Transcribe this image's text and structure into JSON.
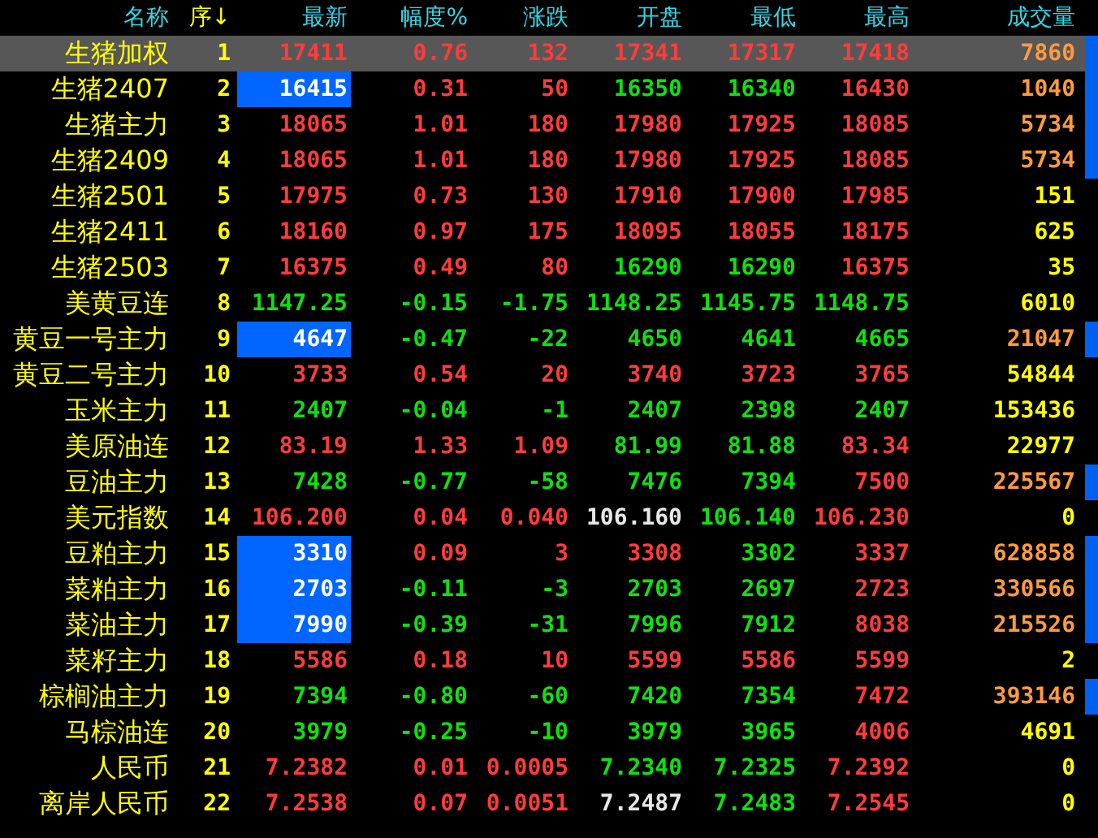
{
  "columns": [
    {
      "label": "名称"
    },
    {
      "label": "序",
      "sort_arrow": "↓"
    },
    {
      "label": "最新"
    },
    {
      "label": "幅度%"
    },
    {
      "label": "涨跌"
    },
    {
      "label": "开盘"
    },
    {
      "label": "最低"
    },
    {
      "label": "最高"
    },
    {
      "label": "成交量"
    }
  ],
  "rows": [
    {
      "name": "生猪加权",
      "seq": "1",
      "selected": true,
      "flagged": true,
      "latest_highlighted": false,
      "values": [
        {
          "text": "17411",
          "color": "#ff3c3c"
        },
        {
          "text": "0.76",
          "color": "#ff3c3c"
        },
        {
          "text": "132",
          "color": "#ff3c3c"
        },
        {
          "text": "17341",
          "color": "#ff3c3c"
        },
        {
          "text": "17317",
          "color": "#ff3c3c"
        },
        {
          "text": "17418",
          "color": "#ff3c3c"
        }
      ],
      "volume": "7860"
    },
    {
      "name": "生猪2407",
      "seq": "2",
      "selected": false,
      "flagged": true,
      "latest_highlighted": true,
      "values": [
        {
          "text": "16415",
          "color": "#ffffff"
        },
        {
          "text": "0.31",
          "color": "#ff3c3c"
        },
        {
          "text": "50",
          "color": "#ff3c3c"
        },
        {
          "text": "16350",
          "color": "#10e010"
        },
        {
          "text": "16340",
          "color": "#10e010"
        },
        {
          "text": "16430",
          "color": "#ff3c3c"
        }
      ],
      "volume": "1040"
    },
    {
      "name": "生猪主力",
      "seq": "3",
      "selected": false,
      "flagged": true,
      "latest_highlighted": false,
      "values": [
        {
          "text": "18065",
          "color": "#ff3c3c"
        },
        {
          "text": "1.01",
          "color": "#ff3c3c"
        },
        {
          "text": "180",
          "color": "#ff3c3c"
        },
        {
          "text": "17980",
          "color": "#ff3c3c"
        },
        {
          "text": "17925",
          "color": "#ff3c3c"
        },
        {
          "text": "18085",
          "color": "#ff3c3c"
        }
      ],
      "volume": "5734"
    },
    {
      "name": "生猪2409",
      "seq": "4",
      "selected": false,
      "flagged": true,
      "latest_highlighted": false,
      "values": [
        {
          "text": "18065",
          "color": "#ff3c3c"
        },
        {
          "text": "1.01",
          "color": "#ff3c3c"
        },
        {
          "text": "180",
          "color": "#ff3c3c"
        },
        {
          "text": "17980",
          "color": "#ff3c3c"
        },
        {
          "text": "17925",
          "color": "#ff3c3c"
        },
        {
          "text": "18085",
          "color": "#ff3c3c"
        }
      ],
      "volume": "5734"
    },
    {
      "name": "生猪2501",
      "seq": "5",
      "selected": false,
      "flagged": false,
      "latest_highlighted": false,
      "values": [
        {
          "text": "17975",
          "color": "#ff3c3c"
        },
        {
          "text": "0.73",
          "color": "#ff3c3c"
        },
        {
          "text": "130",
          "color": "#ff3c3c"
        },
        {
          "text": "17910",
          "color": "#ff3c3c"
        },
        {
          "text": "17900",
          "color": "#ff3c3c"
        },
        {
          "text": "17985",
          "color": "#ff3c3c"
        }
      ],
      "volume": "151"
    },
    {
      "name": "生猪2411",
      "seq": "6",
      "selected": false,
      "flagged": false,
      "latest_highlighted": false,
      "values": [
        {
          "text": "18160",
          "color": "#ff3c3c"
        },
        {
          "text": "0.97",
          "color": "#ff3c3c"
        },
        {
          "text": "175",
          "color": "#ff3c3c"
        },
        {
          "text": "18095",
          "color": "#ff3c3c"
        },
        {
          "text": "18055",
          "color": "#ff3c3c"
        },
        {
          "text": "18175",
          "color": "#ff3c3c"
        }
      ],
      "volume": "625"
    },
    {
      "name": "生猪2503",
      "seq": "7",
      "selected": false,
      "flagged": false,
      "latest_highlighted": false,
      "values": [
        {
          "text": "16375",
          "color": "#ff3c3c"
        },
        {
          "text": "0.49",
          "color": "#ff3c3c"
        },
        {
          "text": "80",
          "color": "#ff3c3c"
        },
        {
          "text": "16290",
          "color": "#10e010"
        },
        {
          "text": "16290",
          "color": "#10e010"
        },
        {
          "text": "16375",
          "color": "#ff3c3c"
        }
      ],
      "volume": "35"
    },
    {
      "name": "美黄豆连",
      "seq": "8",
      "selected": false,
      "flagged": false,
      "latest_highlighted": false,
      "values": [
        {
          "text": "1147.25",
          "color": "#10e010"
        },
        {
          "text": "-0.15",
          "color": "#10e010"
        },
        {
          "text": "-1.75",
          "color": "#10e010"
        },
        {
          "text": "1148.25",
          "color": "#10e010"
        },
        {
          "text": "1145.75",
          "color": "#10e010"
        },
        {
          "text": "1148.75",
          "color": "#10e010"
        }
      ],
      "volume": "6010"
    },
    {
      "name": "黄豆一号主力",
      "seq": "9",
      "selected": false,
      "flagged": true,
      "latest_highlighted": true,
      "values": [
        {
          "text": "4647",
          "color": "#ffffff"
        },
        {
          "text": "-0.47",
          "color": "#10e010"
        },
        {
          "text": "-22",
          "color": "#10e010"
        },
        {
          "text": "4650",
          "color": "#10e010"
        },
        {
          "text": "4641",
          "color": "#10e010"
        },
        {
          "text": "4665",
          "color": "#10e010"
        }
      ],
      "volume": "21047"
    },
    {
      "name": "黄豆二号主力",
      "seq": "10",
      "selected": false,
      "flagged": false,
      "latest_highlighted": false,
      "values": [
        {
          "text": "3733",
          "color": "#ff3c3c"
        },
        {
          "text": "0.54",
          "color": "#ff3c3c"
        },
        {
          "text": "20",
          "color": "#ff3c3c"
        },
        {
          "text": "3740",
          "color": "#ff3c3c"
        },
        {
          "text": "3723",
          "color": "#ff3c3c"
        },
        {
          "text": "3765",
          "color": "#ff3c3c"
        }
      ],
      "volume": "54844"
    },
    {
      "name": "玉米主力",
      "seq": "11",
      "selected": false,
      "flagged": false,
      "latest_highlighted": false,
      "values": [
        {
          "text": "2407",
          "color": "#10e010"
        },
        {
          "text": "-0.04",
          "color": "#10e010"
        },
        {
          "text": "-1",
          "color": "#10e010"
        },
        {
          "text": "2407",
          "color": "#10e010"
        },
        {
          "text": "2398",
          "color": "#10e010"
        },
        {
          "text": "2407",
          "color": "#10e010"
        }
      ],
      "volume": "153436"
    },
    {
      "name": "美原油连",
      "seq": "12",
      "selected": false,
      "flagged": false,
      "latest_highlighted": false,
      "values": [
        {
          "text": "83.19",
          "color": "#ff3c3c"
        },
        {
          "text": "1.33",
          "color": "#ff3c3c"
        },
        {
          "text": "1.09",
          "color": "#ff3c3c"
        },
        {
          "text": "81.99",
          "color": "#10e010"
        },
        {
          "text": "81.88",
          "color": "#10e010"
        },
        {
          "text": "83.34",
          "color": "#ff3c3c"
        }
      ],
      "volume": "22977"
    },
    {
      "name": "豆油主力",
      "seq": "13",
      "selected": false,
      "flagged": true,
      "latest_highlighted": false,
      "values": [
        {
          "text": "7428",
          "color": "#10e010"
        },
        {
          "text": "-0.77",
          "color": "#10e010"
        },
        {
          "text": "-58",
          "color": "#10e010"
        },
        {
          "text": "7476",
          "color": "#10e010"
        },
        {
          "text": "7394",
          "color": "#10e010"
        },
        {
          "text": "7500",
          "color": "#ff3c3c"
        }
      ],
      "volume": "225567"
    },
    {
      "name": "美元指数",
      "seq": "14",
      "selected": false,
      "flagged": false,
      "latest_highlighted": false,
      "values": [
        {
          "text": "106.200",
          "color": "#ff3c3c"
        },
        {
          "text": "0.04",
          "color": "#ff3c3c"
        },
        {
          "text": "0.040",
          "color": "#ff3c3c"
        },
        {
          "text": "106.160",
          "color": "#e8e8e8"
        },
        {
          "text": "106.140",
          "color": "#10e010"
        },
        {
          "text": "106.230",
          "color": "#ff3c3c"
        }
      ],
      "volume": "0"
    },
    {
      "name": "豆粕主力",
      "seq": "15",
      "selected": false,
      "flagged": true,
      "latest_highlighted": true,
      "values": [
        {
          "text": "3310",
          "color": "#ffffff"
        },
        {
          "text": "0.09",
          "color": "#ff3c3c"
        },
        {
          "text": "3",
          "color": "#ff3c3c"
        },
        {
          "text": "3308",
          "color": "#ff3c3c"
        },
        {
          "text": "3302",
          "color": "#10e010"
        },
        {
          "text": "3337",
          "color": "#ff3c3c"
        }
      ],
      "volume": "628858"
    },
    {
      "name": "菜粕主力",
      "seq": "16",
      "selected": false,
      "flagged": true,
      "latest_highlighted": true,
      "values": [
        {
          "text": "2703",
          "color": "#ffffff"
        },
        {
          "text": "-0.11",
          "color": "#10e010"
        },
        {
          "text": "-3",
          "color": "#10e010"
        },
        {
          "text": "2703",
          "color": "#10e010"
        },
        {
          "text": "2697",
          "color": "#10e010"
        },
        {
          "text": "2723",
          "color": "#ff3c3c"
        }
      ],
      "volume": "330566"
    },
    {
      "name": "菜油主力",
      "seq": "17",
      "selected": false,
      "flagged": true,
      "latest_highlighted": true,
      "values": [
        {
          "text": "7990",
          "color": "#ffffff"
        },
        {
          "text": "-0.39",
          "color": "#10e010"
        },
        {
          "text": "-31",
          "color": "#10e010"
        },
        {
          "text": "7996",
          "color": "#10e010"
        },
        {
          "text": "7912",
          "color": "#10e010"
        },
        {
          "text": "8038",
          "color": "#ff3c3c"
        }
      ],
      "volume": "215526"
    },
    {
      "name": "菜籽主力",
      "seq": "18",
      "selected": false,
      "flagged": false,
      "latest_highlighted": false,
      "values": [
        {
          "text": "5586",
          "color": "#ff3c3c"
        },
        {
          "text": "0.18",
          "color": "#ff3c3c"
        },
        {
          "text": "10",
          "color": "#ff3c3c"
        },
        {
          "text": "5599",
          "color": "#ff3c3c"
        },
        {
          "text": "5586",
          "color": "#ff3c3c"
        },
        {
          "text": "5599",
          "color": "#ff3c3c"
        }
      ],
      "volume": "2"
    },
    {
      "name": "棕榈油主力",
      "seq": "19",
      "selected": false,
      "flagged": true,
      "latest_highlighted": false,
      "values": [
        {
          "text": "7394",
          "color": "#10e010"
        },
        {
          "text": "-0.80",
          "color": "#10e010"
        },
        {
          "text": "-60",
          "color": "#10e010"
        },
        {
          "text": "7420",
          "color": "#10e010"
        },
        {
          "text": "7354",
          "color": "#10e010"
        },
        {
          "text": "7472",
          "color": "#ff3c3c"
        }
      ],
      "volume": "393146"
    },
    {
      "name": "马棕油连",
      "seq": "20",
      "selected": false,
      "flagged": false,
      "latest_highlighted": false,
      "values": [
        {
          "text": "3979",
          "color": "#10e010"
        },
        {
          "text": "-0.25",
          "color": "#10e010"
        },
        {
          "text": "-10",
          "color": "#10e010"
        },
        {
          "text": "3979",
          "color": "#10e010"
        },
        {
          "text": "3965",
          "color": "#10e010"
        },
        {
          "text": "4006",
          "color": "#ff3c3c"
        }
      ],
      "volume": "4691"
    },
    {
      "name": "人民币",
      "seq": "21",
      "selected": false,
      "flagged": false,
      "latest_highlighted": false,
      "values": [
        {
          "text": "7.2382",
          "color": "#ff3c3c"
        },
        {
          "text": "0.01",
          "color": "#ff3c3c"
        },
        {
          "text": "0.0005",
          "color": "#ff3c3c"
        },
        {
          "text": "7.2340",
          "color": "#10e010"
        },
        {
          "text": "7.2325",
          "color": "#10e010"
        },
        {
          "text": "7.2392",
          "color": "#ff3c3c"
        }
      ],
      "volume": "0"
    },
    {
      "name": "离岸人民币",
      "seq": "22",
      "selected": false,
      "flagged": false,
      "latest_highlighted": false,
      "values": [
        {
          "text": "7.2538",
          "color": "#ff3c3c"
        },
        {
          "text": "0.07",
          "color": "#ff3c3c"
        },
        {
          "text": "0.0051",
          "color": "#ff3c3c"
        },
        {
          "text": "7.2487",
          "color": "#e8e8e8"
        },
        {
          "text": "7.2483",
          "color": "#10e010"
        },
        {
          "text": "7.2545",
          "color": "#ff3c3c"
        }
      ],
      "volume": "0"
    }
  ]
}
